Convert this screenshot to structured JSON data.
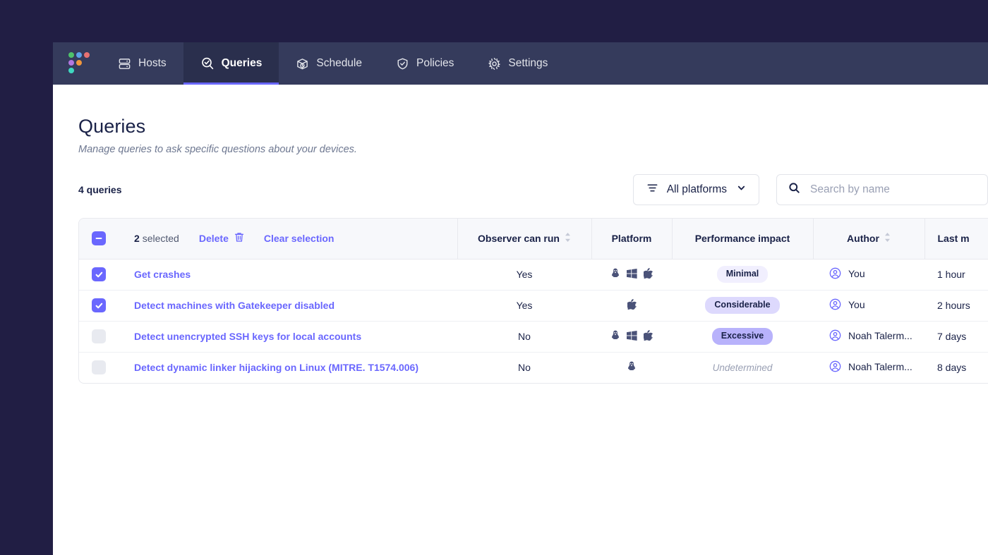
{
  "window": {
    "background_color": "#211e44",
    "accent_color": "#6a67fe",
    "navbar_color": "#353b5c"
  },
  "nav": {
    "logo_name": "fleet-logo",
    "logo_dots": [
      {
        "color": "#4ec26b"
      },
      {
        "color": "#5aa1e8"
      },
      {
        "color": "#e87171"
      },
      {
        "color": "#b277e0"
      },
      {
        "color": "#f0963c"
      },
      {
        "color": "#3fd7c0"
      }
    ],
    "items": [
      {
        "label": "Hosts",
        "icon": "server-icon",
        "active": false
      },
      {
        "label": "Queries",
        "icon": "magnifier-check-icon",
        "active": true
      },
      {
        "label": "Schedule",
        "icon": "box-clock-icon",
        "active": false
      },
      {
        "label": "Policies",
        "icon": "shield-check-icon",
        "active": false
      },
      {
        "label": "Settings",
        "icon": "gear-icon",
        "active": false
      }
    ]
  },
  "page": {
    "title": "Queries",
    "subtitle": "Manage queries to ask specific questions about your devices."
  },
  "controls": {
    "count_label": "4 queries",
    "platform_filter": {
      "icon": "filter-lines-icon",
      "label": "All platforms",
      "chevron": "chevron-down-icon"
    },
    "search": {
      "icon": "search-icon",
      "placeholder": "Search by name",
      "value": ""
    }
  },
  "table": {
    "bulk": {
      "selected_label_count": "2",
      "selected_label_rest": "selected",
      "delete_label": "Delete",
      "delete_icon": "trash-icon",
      "clear_label": "Clear selection",
      "header_checkbox_state": "indeterminate"
    },
    "columns": [
      {
        "key": "observer",
        "label": "Observer can run",
        "sortable": true
      },
      {
        "key": "platform",
        "label": "Platform",
        "sortable": false
      },
      {
        "key": "impact",
        "label": "Performance impact",
        "sortable": false
      },
      {
        "key": "author",
        "label": "Author",
        "sortable": true
      },
      {
        "key": "modified",
        "label": "Last m",
        "sortable": false
      }
    ],
    "rows": [
      {
        "selected": true,
        "name": "Get crashes",
        "observer_can_run": "Yes",
        "platforms": [
          "linux",
          "windows",
          "apple"
        ],
        "impact": "Minimal",
        "impact_level": "minimal",
        "author": "You",
        "author_icon": "user-circle-icon",
        "last_modified": "1 hour"
      },
      {
        "selected": true,
        "name": "Detect machines with Gatekeeper disabled",
        "observer_can_run": "Yes",
        "platforms": [
          "apple"
        ],
        "impact": "Considerable",
        "impact_level": "considerable",
        "author": "You",
        "author_icon": "user-circle-icon",
        "last_modified": "2 hours"
      },
      {
        "selected": false,
        "name": "Detect unencrypted SSH keys for local accounts",
        "observer_can_run": "No",
        "platforms": [
          "linux",
          "windows",
          "apple"
        ],
        "impact": "Excessive",
        "impact_level": "excessive",
        "author": "Noah Talerm...",
        "author_icon": "user-circle-icon",
        "last_modified": "7 days"
      },
      {
        "selected": false,
        "name": "Detect dynamic linker hijacking on Linux (MITRE. T1574.006)",
        "observer_can_run": "No",
        "platforms": [
          "linux"
        ],
        "impact": "Undetermined",
        "impact_level": "undetermined",
        "author": "Noah Talerm...",
        "author_icon": "user-circle-icon",
        "last_modified": "8 days"
      }
    ]
  }
}
